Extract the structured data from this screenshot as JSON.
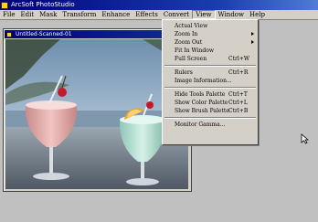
{
  "app": {
    "title": "ArcSoft PhotoStudio"
  },
  "menubar": {
    "items": [
      "File",
      "Edit",
      "Mask",
      "Transform",
      "Enhance",
      "Effects",
      "Convert",
      "View",
      "Window",
      "Help"
    ],
    "active": "View"
  },
  "document": {
    "title": "Untitled-Scanned-01"
  },
  "view_menu": {
    "items": [
      {
        "label": "Actual View",
        "shortcut": ""
      },
      {
        "label": "Zoom In",
        "shortcut": "",
        "submenu": true
      },
      {
        "label": "Zoom Out",
        "shortcut": "",
        "submenu": true
      },
      {
        "label": "Fit In Window",
        "shortcut": ""
      },
      {
        "label": "Full Screen",
        "shortcut": "Ctrl+W"
      },
      {
        "label": "Rulers",
        "shortcut": "Ctrl+R"
      },
      {
        "label": "Image Information...",
        "shortcut": ""
      },
      {
        "label": "Hide Tools Palette",
        "shortcut": "Ctrl+T"
      },
      {
        "label": "Show Color Palette",
        "shortcut": "Ctrl+L"
      },
      {
        "label": "Show Brush Palette",
        "shortcut": "Ctrl+B"
      },
      {
        "label": "Monitor Gamma...",
        "shortcut": ""
      }
    ]
  },
  "colors": {
    "titlebar": "#00007b",
    "menu_bg": "#d4d0c8",
    "workspace": "#c0c0c0"
  }
}
